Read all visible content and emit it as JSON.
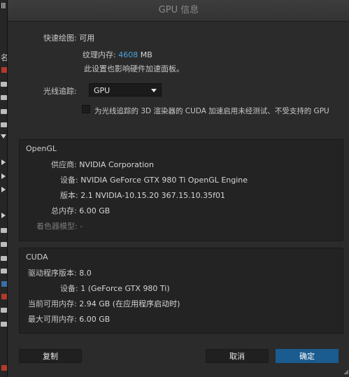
{
  "background_app": {
    "left_chars": [
      "Ⅲ",
      "名"
    ]
  },
  "dialog": {
    "title": "GPU 信息",
    "fast_draw": {
      "label": "快速绘图:",
      "value": "可用"
    },
    "texture_memory": {
      "label": "纹理内存:",
      "value": "4608",
      "unit": "MB"
    },
    "note": "此设置也影响硬件加速面板。",
    "ray_tracing": {
      "label": "光线追踪:",
      "selected": "GPU",
      "checkbox_label": "为光线追踪的 3D 渲染器的 CUDA 加速启用未经测试、不受支持的 GPU"
    },
    "opengl": {
      "title": "OpenGL",
      "rows": [
        {
          "label": "供应商:",
          "value": "NVIDIA Corporation"
        },
        {
          "label": "设备:",
          "value": "NVIDIA GeForce GTX 980 Ti OpenGL Engine"
        },
        {
          "label": "版本:",
          "value": "2.1 NVIDIA-10.15.20 367.15.10.35f01"
        },
        {
          "label": "总内存:",
          "value": "6.00 GB"
        },
        {
          "label": "着色器模型:",
          "value": "-"
        }
      ]
    },
    "cuda": {
      "title": "CUDA",
      "rows": [
        {
          "label": "驱动程序版本:",
          "value": "8.0"
        },
        {
          "label": "设备:",
          "value": "1 (GeForce GTX 980 Ti)"
        },
        {
          "label": "当前可用内存:",
          "value": "2.94 GB (在应用程序启动时)"
        },
        {
          "label": "最大可用内存:",
          "value": "6.00 GB"
        }
      ]
    },
    "buttons": {
      "copy": "复制",
      "cancel": "取消",
      "ok": "确定"
    },
    "colors": {
      "accent": "#4aa3df",
      "primary_button": "#1a5c8f"
    }
  }
}
